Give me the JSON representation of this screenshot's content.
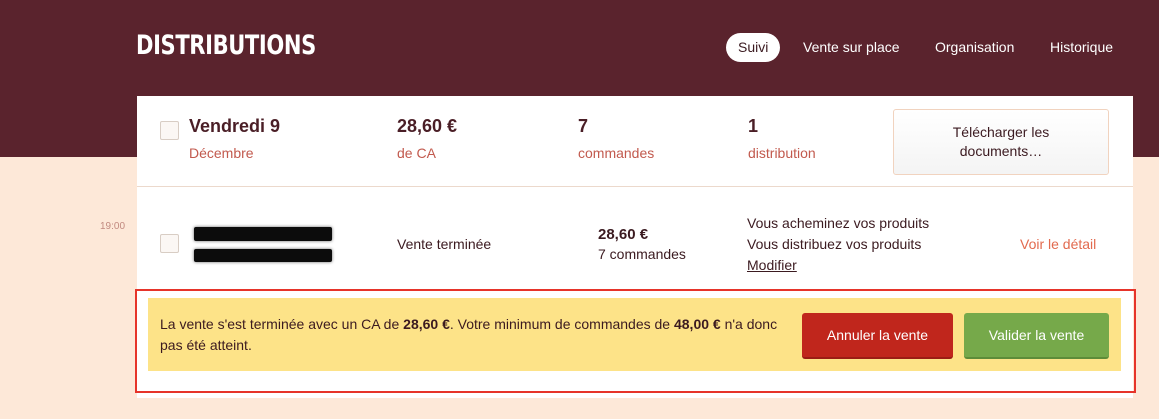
{
  "header": {
    "title": "DISTRIBUTIONS",
    "nav": [
      {
        "label": "Suivi",
        "active": true
      },
      {
        "label": "Vente sur place",
        "active": false
      },
      {
        "label": "Organisation",
        "active": false
      },
      {
        "label": "Historique",
        "active": false
      }
    ]
  },
  "summary": {
    "day": "Vendredi 9",
    "month": "Décembre",
    "revenue": "28,60 €",
    "revenue_label": "de CA",
    "orders_count": "7",
    "orders_label": "commandes",
    "distribution_count": "1",
    "distribution_label": "distribution",
    "download_button": "Télécharger les documents…"
  },
  "sale": {
    "time": "19:00",
    "status": "Vente terminée",
    "amount": "28,60 €",
    "orders": "7 commandes",
    "delivery_line1": "Vous acheminez vos produits",
    "delivery_line2": "Vous distribuez vos produits",
    "modify_link": "Modifier",
    "detail_link": "Voir le détail"
  },
  "alert": {
    "text_part1": "La vente s'est terminée avec un CA de ",
    "amount": "28,60 €",
    "text_part2": ". Votre minimum de commandes de ",
    "minimum": "48,00 €",
    "text_part3": " n'a donc pas été atteint.",
    "cancel_button": "Annuler la vente",
    "validate_button": "Valider la vente"
  },
  "colors": {
    "header_bg": "#5a232d",
    "page_bg": "#fde8d8",
    "accent_text": "#c25a4e",
    "link": "#e26a4e",
    "alert_bg": "#fde388",
    "cancel": "#c0261c",
    "validate": "#76a94a",
    "highlight": "#e6342a"
  }
}
